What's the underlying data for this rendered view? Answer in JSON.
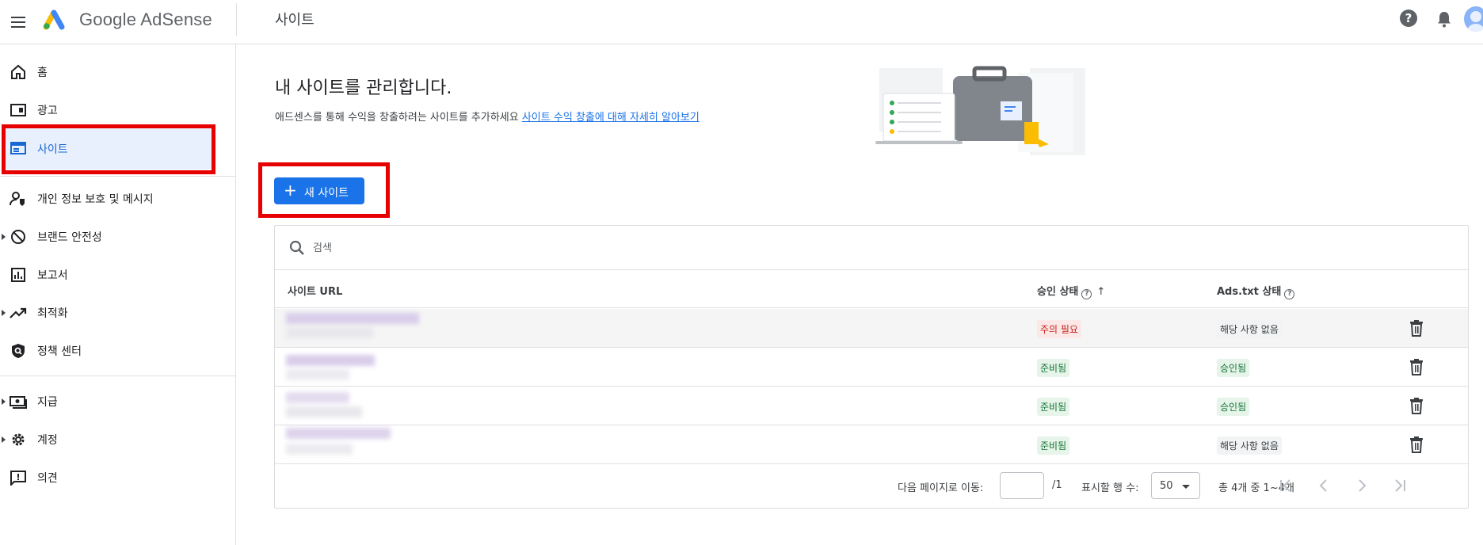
{
  "app": {
    "logo_text": "Google AdSense",
    "page_title": "사이트"
  },
  "sidebar": {
    "items": [
      {
        "label": "홈",
        "icon": "home-icon"
      },
      {
        "label": "광고",
        "icon": "ads-icon"
      },
      {
        "label": "사이트",
        "icon": "sites-icon",
        "active": true
      },
      {
        "label": "개인 정보 보호 및 메시지",
        "icon": "privacy-icon"
      },
      {
        "label": "브랜드 안전성",
        "icon": "block-icon",
        "expandable": true
      },
      {
        "label": "보고서",
        "icon": "reports-icon"
      },
      {
        "label": "최적화",
        "icon": "trending-icon",
        "expandable": true
      },
      {
        "label": "정책 센터",
        "icon": "policy-icon"
      },
      {
        "label": "지급",
        "icon": "payments-icon",
        "expandable": true
      },
      {
        "label": "계정",
        "icon": "gear-icon",
        "expandable": true
      },
      {
        "label": "의견",
        "icon": "feedback-icon"
      }
    ]
  },
  "main": {
    "heading": "내 사이트를 관리합니다.",
    "subtext": "애드센스를 통해 수익을 창출하려는 사이트를 추가하세요",
    "learn_more": "사이트 수익 창출에 대해 자세히 알아보기",
    "new_site_button": "새 사이트",
    "search_placeholder": "검색"
  },
  "table": {
    "columns": {
      "url": "사이트 URL",
      "approval": "승인 상태",
      "adstxt": "Ads.txt 상태"
    },
    "rows": [
      {
        "approval": "주의 필요",
        "adstxt": "해당 사항 없음"
      },
      {
        "approval": "준비됨",
        "adstxt": "승인됨"
      },
      {
        "approval": "준비됨",
        "adstxt": "승인됨"
      },
      {
        "approval": "준비됨",
        "adstxt": "해당 사항 없음"
      }
    ],
    "footer": {
      "goto_label": "다음 페이지로 이동:",
      "page_total": "/1",
      "rows_label": "표시할 행 수:",
      "rows_value": "50",
      "range": "총 4개 중 1~4개"
    }
  },
  "colors": {
    "accent": "#1a73e8",
    "highlight_box": "#e60000",
    "active_nav_bg": "#e8f0fe"
  }
}
